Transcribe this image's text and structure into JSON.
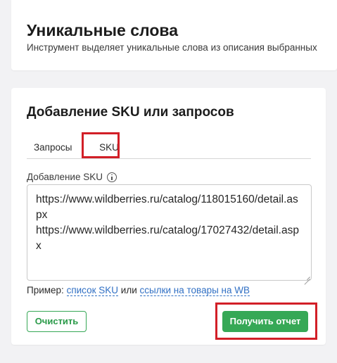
{
  "header": {
    "title": "Уникальные слова",
    "subtitle": "Инструмент выделяет уникальные слова из описания выбранных"
  },
  "form": {
    "section_title": "Добавление SKU или запросов",
    "tabs": [
      {
        "label": "Запросы",
        "active": false
      },
      {
        "label": "SKU",
        "active": true
      }
    ],
    "field_label": "Добавление SKU",
    "textarea_value": "https://www.wildberries.ru/catalog/118015160/detail.aspx\nhttps://www.wildberries.ru/catalog/17027432/detail.aspx",
    "example_prefix": "Пример:",
    "example_link_1": "список SKU",
    "example_middle": "или",
    "example_link_2": "ссылки на товары на WB",
    "clear_button": "Очистить",
    "report_button": "Получить отчет"
  },
  "colors": {
    "accent_green": "#36a856",
    "link_blue": "#3170c4",
    "highlight_red": "#d21f27"
  }
}
